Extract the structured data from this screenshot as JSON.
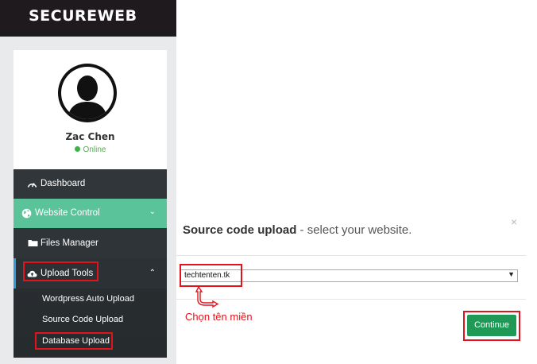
{
  "brand": {
    "title": "SECUREWEB"
  },
  "profile": {
    "name": "Zac Chen",
    "status": "Online",
    "avatar_icon": "user-silhouette-icon"
  },
  "menu": {
    "dashboard": "Dashboard",
    "website_control": "Website Control",
    "files_manager": "Files Manager",
    "upload_tools": "Upload Tools",
    "upload_submenu": [
      "Wordpress Auto Upload",
      "Source Code Upload",
      "Database Upload"
    ]
  },
  "modal": {
    "title_bold": "Source code upload",
    "title_sub": "- select your website.",
    "close": "×",
    "select_value": "techtenten.tk",
    "continue_label": "Continue"
  },
  "annotation": {
    "text": "Chọn tên miền"
  },
  "colors": {
    "brand_bg": "#1f1a1d",
    "menu_bg": "#2b3033",
    "active_green": "#5bc39a",
    "continue_green": "#1f9a56",
    "highlight_red": "#e3131b",
    "online_green": "#3cb34a"
  }
}
